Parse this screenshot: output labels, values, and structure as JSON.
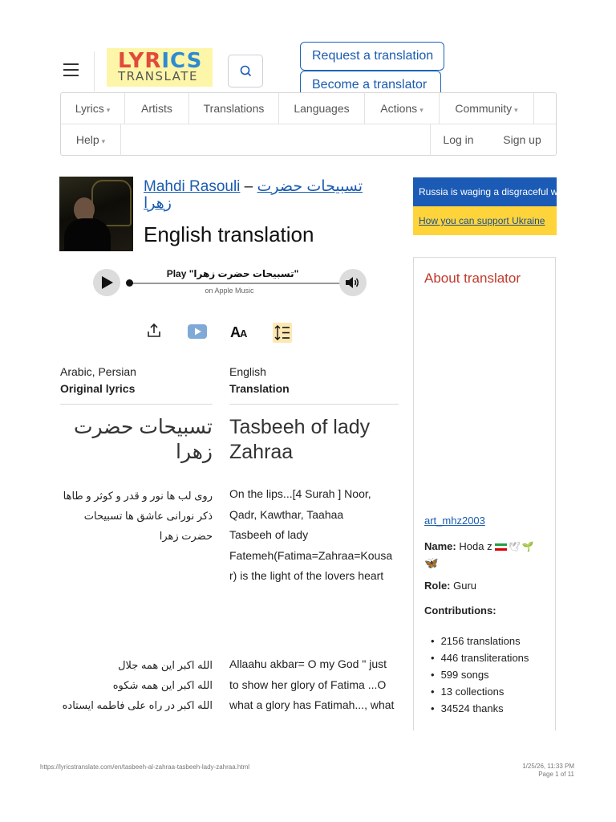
{
  "header": {
    "logo_line1_a": "LYR",
    "logo_line1_b": "ICS",
    "logo_line2": "TRANSLATE",
    "request_label": "Request a translation",
    "become_label": "Become a translator"
  },
  "nav": {
    "row1": [
      {
        "label": "Lyrics",
        "caret": true
      },
      {
        "label": "Artists",
        "caret": false
      },
      {
        "label": "Translations",
        "caret": false
      },
      {
        "label": "Languages",
        "caret": false
      },
      {
        "label": "Actions",
        "caret": true
      },
      {
        "label": "Community",
        "caret": true
      }
    ],
    "help": "Help",
    "login": "Log in",
    "signup": "Sign up"
  },
  "song": {
    "artist": "Mahdi Rasouli",
    "dash": " – ",
    "title_part1": "تسبیحات حضرت",
    "title_part2": "زهرا",
    "translation_heading": "English translation"
  },
  "player": {
    "title": "Play \"تسبیحات حضرت زهرا\"",
    "subtitle": "on Apple Music"
  },
  "toolbar": {
    "font_icon_big": "A",
    "font_icon_small": "A"
  },
  "lyrics": {
    "original_lang": "Arabic, Persian",
    "original_label": "Original lyrics",
    "translation_lang": "English",
    "translation_label": "Translation",
    "original_title": "تسبیحات حضرت زهرا",
    "translation_title": "Tasbeeh of lady Zahraa",
    "original_block1": [
      "روی لب ها نور و قدر و کوثر و طاها",
      "ذکر نورانی عاشق ها تسبیحات",
      "حضرت زهرا"
    ],
    "translation_block1": [
      "On the lips...[4 Surah ] Noor,",
      "Qadr, Kawthar, Taahaa",
      "Tasbeeh of lady",
      "Fatemeh(Fatima=Zahraa=Kousa",
      "r) is the light of the lovers heart"
    ],
    "original_block2": [
      "الله اکبر این همه جلال",
      "الله اکبر این همه شکوه",
      "الله اکبر در راه علی فاطمه ایستاده"
    ],
    "translation_block2": [
      "Allaahu akbar= O my God \" just",
      "to show her glory of Fatima ...O",
      "what a glory has Fatimah..., what"
    ]
  },
  "sidebar": {
    "ua_text": "Russia is waging a disgraceful war on Ukraine",
    "ua_link": "How you can support Ukraine",
    "about_title": "About translator",
    "username": "art_mhz2003",
    "name_label": "Name:",
    "name_value": "Hoda z",
    "role_label": "Role:",
    "role_value": "Guru",
    "contrib_label": "Contributions:",
    "contributions": [
      "2156 translations",
      "446 transliterations",
      "599 songs",
      "13 collections",
      "34524 thanks"
    ]
  },
  "footer": {
    "url": "https://lyricstranslate.com/en/tasbeeh-al-zahraa-tasbeeh-lady-zahraa.html",
    "datetime": "1/25/26, 11:33 PM",
    "page": "Page 1 of 11"
  }
}
